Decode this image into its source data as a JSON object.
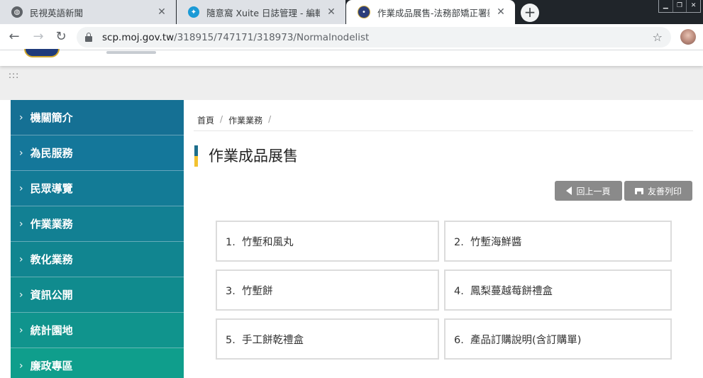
{
  "browser": {
    "tabs": [
      {
        "title": "民視英語新聞",
        "favicon": "globe-icon",
        "active": false
      },
      {
        "title": "隨意窩 Xuite 日誌管理 - 編輯文章",
        "favicon": "xuite-icon",
        "active": false
      },
      {
        "title": "作業成品展售-法務部矯正署新竹",
        "favicon": "moj-icon",
        "active": true
      }
    ],
    "url_host": "scp.moj.gov.tw",
    "url_path": "/318915/747171/318973/Normalnodelist"
  },
  "sidebar": {
    "items": [
      {
        "label": "機關簡介"
      },
      {
        "label": "為民服務"
      },
      {
        "label": "民眾導覽"
      },
      {
        "label": "作業業務"
      },
      {
        "label": "教化業務"
      },
      {
        "label": "資訊公開"
      },
      {
        "label": "統計園地"
      },
      {
        "label": "廉政專區"
      }
    ]
  },
  "breadcrumb": {
    "home": "首頁",
    "current": "作業業務",
    "separator": "/"
  },
  "page": {
    "title": "作業成品展售",
    "back_label": "回上一頁",
    "print_label": "友善列印"
  },
  "products": [
    {
      "label": "1.  竹塹和風丸"
    },
    {
      "label": "2.  竹塹海鮮醬"
    },
    {
      "label": "3.  竹塹餅"
    },
    {
      "label": "4.  鳳梨蔓越莓餅禮盒"
    },
    {
      "label": "5.  手工餅乾禮盒"
    },
    {
      "label": "6.  產品訂購說明(含訂購單)"
    }
  ],
  "colors": {
    "sidebar_top": "#157094",
    "sidebar_bottom": "#0f9e8c",
    "accent_blue": "#1c6e8c",
    "accent_yellow": "#f2c230",
    "button_gray": "#8a8a8a"
  }
}
